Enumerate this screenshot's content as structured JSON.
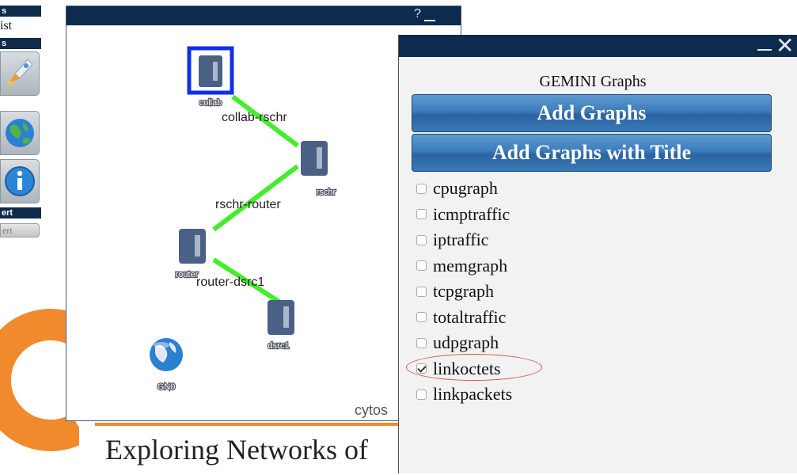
{
  "sidebar": {
    "head1": "s",
    "text1": "ist",
    "head2": "s",
    "head3": "",
    "head4": "ert",
    "small_btn": "ert",
    "buttons": [
      {
        "icon": "rocket-icon"
      },
      {
        "icon": "globe-icon"
      },
      {
        "icon": "info-icon"
      }
    ]
  },
  "background": {
    "tagline": "Exploring Networks of",
    "accent_color": "#f08a2c"
  },
  "topology": {
    "help": "?",
    "footer": "cytos",
    "nodes": [
      {
        "id": "collab",
        "label": "collab",
        "selected": true
      },
      {
        "id": "rschr",
        "label": "rschr"
      },
      {
        "id": "router",
        "label": "router"
      },
      {
        "id": "dsrc1",
        "label": "dsrc1"
      },
      {
        "id": "gn",
        "label": "GN0"
      }
    ],
    "edges": [
      {
        "label": "collab-rschr"
      },
      {
        "label": "rschr-router"
      },
      {
        "label": "router-dsrc1"
      }
    ],
    "edge_color": "#43ee2a",
    "selection_color": "#1030e8"
  },
  "gemini": {
    "close": "✕",
    "title": "GEMINI Graphs",
    "add_graphs": "Add Graphs",
    "add_graphs_title": "Add Graphs with Title",
    "graphs": [
      {
        "label": "cpugraph",
        "checked": false
      },
      {
        "label": "icmptraffic",
        "checked": false
      },
      {
        "label": "iptraffic",
        "checked": false
      },
      {
        "label": "memgraph",
        "checked": false
      },
      {
        "label": "tcpgraph",
        "checked": false
      },
      {
        "label": "totaltraffic",
        "checked": false
      },
      {
        "label": "udpgraph",
        "checked": false
      },
      {
        "label": "linkoctets",
        "checked": true
      },
      {
        "label": "linkpackets",
        "checked": false
      }
    ]
  }
}
